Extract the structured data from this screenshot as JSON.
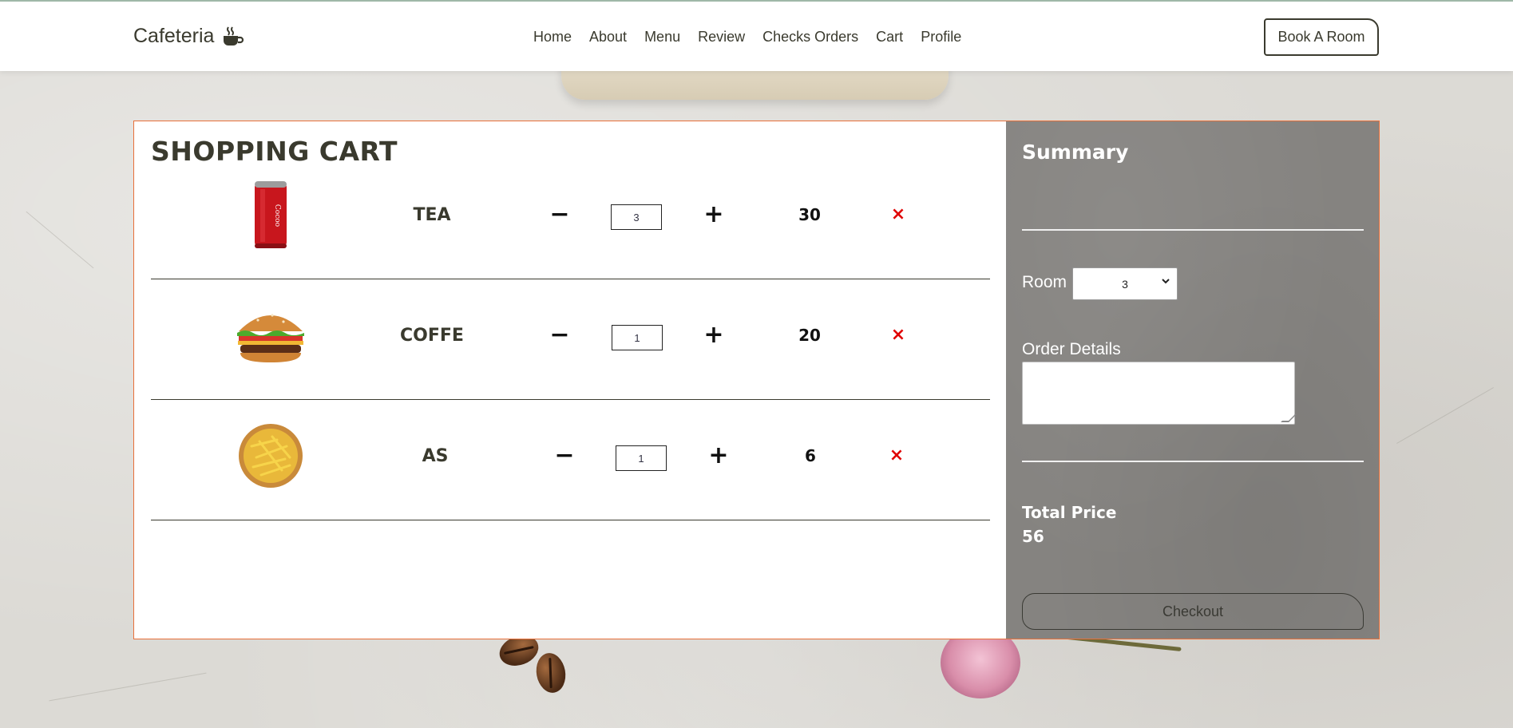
{
  "nav": {
    "brand": "Cafeteria",
    "brand_icon": "coffee-cup-icon",
    "links": [
      "Home",
      "About",
      "Menu",
      "Review",
      "Checks Orders",
      "Cart",
      "Profile"
    ],
    "book_button": "Book A Room"
  },
  "cart": {
    "title": "SHOPPING CART",
    "items": [
      {
        "name": "TEA",
        "image": "soda-can-image",
        "quantity": "3",
        "price": "30",
        "remove": "×"
      },
      {
        "name": "COFFE",
        "image": "burger-image",
        "quantity": "1",
        "price": "20",
        "remove": "×"
      },
      {
        "name": "AS",
        "image": "fries-image",
        "quantity": "1",
        "price": "6",
        "remove": "×"
      }
    ],
    "minus_symbol": "−",
    "plus_symbol": "+"
  },
  "summary": {
    "title": "Summary",
    "room_label": "Room",
    "room_selected": "3",
    "details_label": "Order Details",
    "details_value": "",
    "total_label": "Total Price",
    "total_value": "56",
    "checkout_label": "Checkout"
  },
  "colors": {
    "accent_border": "#e8703a",
    "remove_red": "#e00000",
    "summary_bg": "#858380"
  }
}
